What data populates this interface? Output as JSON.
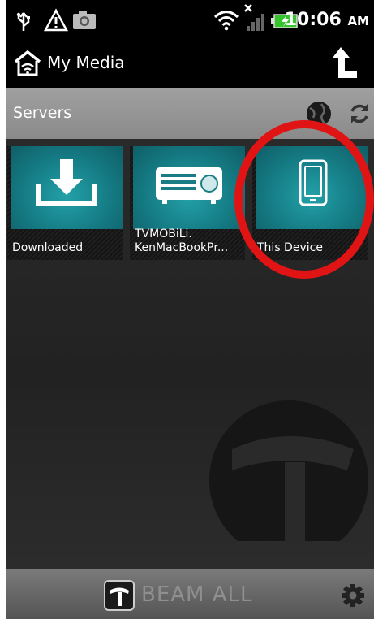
{
  "status_bar": {
    "time": "10:06",
    "ampm": "AM",
    "icons": [
      "usb-icon",
      "warning-icon",
      "camera-icon",
      "wifi-icon",
      "no-signal-icon",
      "battery-charging-icon"
    ]
  },
  "header": {
    "title": "My Media",
    "icons": [
      "home-wifi-icon",
      "up-arrow-icon"
    ]
  },
  "servers_bar": {
    "label": "Servers",
    "icons": [
      "globe-icon",
      "refresh-icon"
    ]
  },
  "servers": [
    {
      "label": "Downloaded",
      "icon": "download-icon"
    },
    {
      "label": "TVMOBiLi.\nKenMacBookPr...",
      "line1": "TVMOBiLi.",
      "line2": "KenMacBookPr...",
      "icon": "projector-icon"
    },
    {
      "label": "This Device",
      "icon": "phone-icon"
    }
  ],
  "bottom_bar": {
    "beam_label": "BEAM ALL",
    "icons": [
      "tvmobili-logo-icon",
      "gear-icon"
    ]
  },
  "colors": {
    "tile_teal": "#157b84",
    "highlight_ring": "#e01414",
    "background": "#1c1c1c"
  }
}
